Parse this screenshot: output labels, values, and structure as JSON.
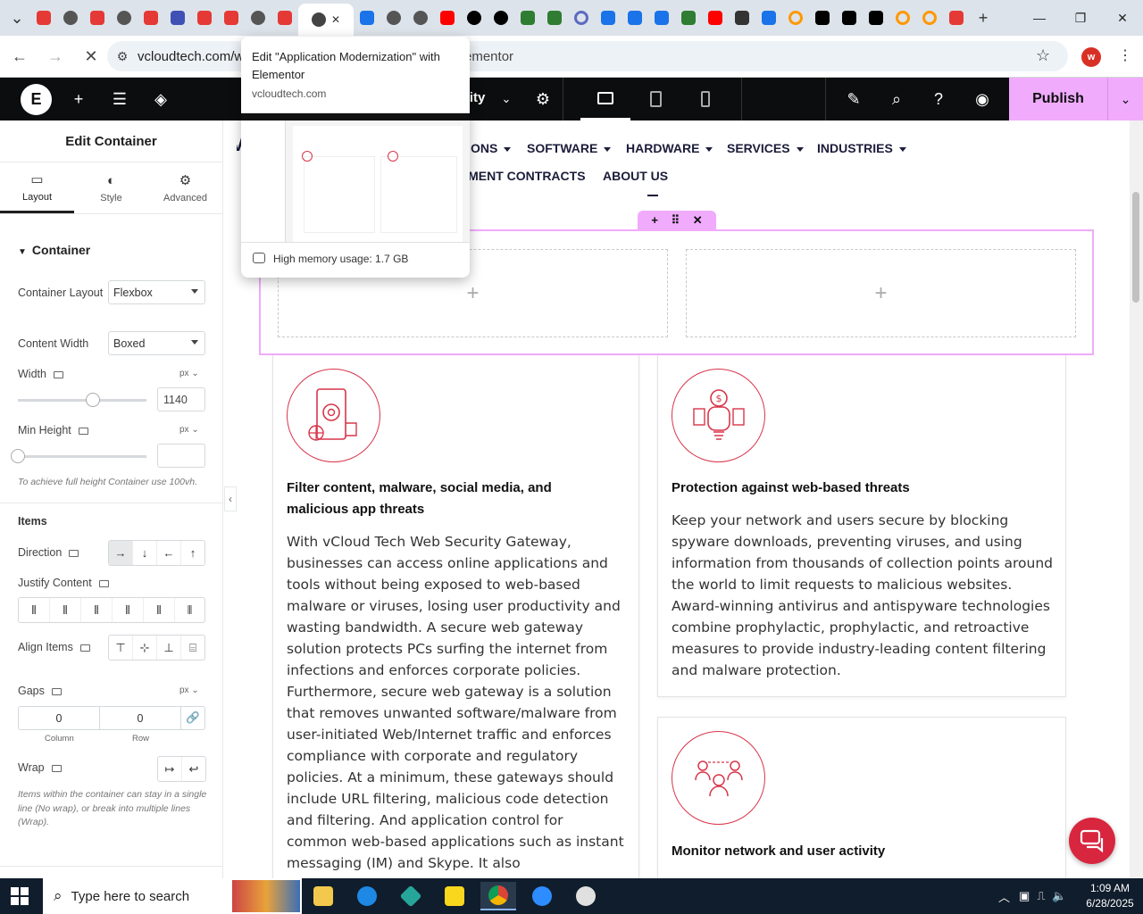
{
  "browser": {
    "tabs": [
      {
        "icon": "shield-tab-icon",
        "color": "#e53935"
      },
      {
        "icon": "globe-tab-icon",
        "color": "#555555"
      },
      {
        "icon": "shield-tab-icon",
        "color": "#e53935"
      },
      {
        "icon": "globe-tab-icon",
        "color": "#555555"
      },
      {
        "icon": "shield-tab-icon",
        "color": "#e53935"
      },
      {
        "icon": "gear-tab-icon",
        "color": "#3f51b5"
      },
      {
        "icon": "shield-tab-icon",
        "color": "#e53935"
      },
      {
        "icon": "shield-tab-icon",
        "color": "#e53935"
      },
      {
        "icon": "globe-tab-icon",
        "color": "#555555"
      },
      {
        "icon": "shield-tab-icon",
        "color": "#e53935"
      },
      {
        "icon": "globe-tab-icon",
        "color": "#444444",
        "active": true
      },
      {
        "icon": "chart-tab-icon",
        "color": "#1a73e8"
      },
      {
        "icon": "globe-tab-icon",
        "color": "#555555"
      },
      {
        "icon": "globe-tab-icon",
        "color": "#555555"
      },
      {
        "icon": "youtube-tab-icon",
        "color": "#ff0000"
      },
      {
        "icon": "threads-tab-icon",
        "color": "#000000"
      },
      {
        "icon": "threads-tab-icon",
        "color": "#000000"
      },
      {
        "icon": "bolt-tab-icon",
        "color": "#2e7d32"
      },
      {
        "icon": "bolt-tab-icon",
        "color": "#2e7d32"
      },
      {
        "icon": "ring-tab-icon",
        "color": "#5c6bc0"
      },
      {
        "icon": "chart-tab-icon",
        "color": "#1a73e8"
      },
      {
        "icon": "dots-tab-icon",
        "color": "#1a73e8"
      },
      {
        "icon": "dots-tab-icon",
        "color": "#1a73e8"
      },
      {
        "icon": "bolt-tab-icon",
        "color": "#2e7d32"
      },
      {
        "icon": "youtube-tab-icon",
        "color": "#ff0000"
      },
      {
        "icon": "lock-tab-icon",
        "color": "#333333"
      },
      {
        "icon": "wave-tab-icon",
        "color": "#1a73e8"
      },
      {
        "icon": "ring-tab-icon",
        "color": "#ff9800"
      },
      {
        "icon": "x-tab-icon",
        "color": "#000000"
      },
      {
        "icon": "x-tab-icon",
        "color": "#000000"
      },
      {
        "icon": "n-tab-icon",
        "color": "#000000"
      },
      {
        "icon": "ring-tab-icon",
        "color": "#ff9800"
      },
      {
        "icon": "ring-tab-icon",
        "color": "#ff9800"
      },
      {
        "icon": "slash-tab-icon",
        "color": "#e53935"
      }
    ],
    "url": "vcloudtech.com/w",
    "url_tail": "ementor",
    "profile_initial": "w"
  },
  "tooltip": {
    "title": "Edit \"Application Modernization\" with Elementor",
    "domain": "vcloudtech.com",
    "memory": "High memory usage: 1.7 GB"
  },
  "editor": {
    "site_name_fragment": "rity",
    "publish_label": "Publish"
  },
  "panel": {
    "title": "Edit Container",
    "tabs": [
      "Layout",
      "Style",
      "Advanced"
    ],
    "section": "Container",
    "container_layout_label": "Container Layout",
    "container_layout_value": "Flexbox",
    "content_width_label": "Content Width",
    "content_width_value": "Boxed",
    "width_label": "Width",
    "width_unit": "px",
    "width_value": "1140",
    "width_slider_fraction": 0.58,
    "min_height_label": "Min Height",
    "min_height_unit": "px",
    "min_height_value": "",
    "min_height_slider_fraction": 0,
    "min_height_hint": "To achieve full height Container use 100vh.",
    "items_heading": "Items",
    "direction_label": "Direction",
    "direction_options": [
      "→",
      "↓",
      "←",
      "↑"
    ],
    "direction_selected": 0,
    "justify_label": "Justify Content",
    "align_label": "Align Items",
    "gaps_label": "Gaps",
    "gaps_unit": "px",
    "gap_column": "0",
    "gap_row": "0",
    "gap_column_label": "Column",
    "gap_row_label": "Row",
    "wrap_label": "Wrap",
    "wrap_hint": "Items within the container can stay in a single line (No wrap), or break into multiple lines (Wrap)."
  },
  "site": {
    "menu_row1": [
      "ONS",
      "SOFTWARE",
      "HARDWARE",
      "SERVICES",
      "INDUSTRIES"
    ],
    "menu_row2": [
      "NMENT CONTRACTS",
      "ABOUT US"
    ],
    "cards": [
      {
        "title": "Filter content, malware, social media, and malicious app threats",
        "body": "With vCloud Tech Web Security Gateway, businesses can access online applications and tools without being exposed to web-based malware or viruses, losing user productivity and wasting bandwidth. A secure web gateway solution protects PCs surfing the internet from infections and enforces corporate policies. Furthermore, secure web gateway is a solution that removes unwanted software/malware from user-initiated Web/Internet traffic and enforces compliance with corporate and regulatory policies. At a minimum, these gateways should include URL filtering, malicious code detection and filtering. And application control for common web-based applications such as instant messaging (IM) and Skype. It also"
      },
      {
        "title": "Protection against web-based threats",
        "body": "Keep your network and users secure by blocking spyware downloads, preventing viruses, and using information from thousands of collection points around the world to limit requests to malicious websites. Award-winning antivirus and antispyware technologies combine prophylactic, prophylactic, and retroactive measures to provide industry-leading content filtering and malware protection."
      },
      {
        "title": "Monitor network and user activity",
        "body": ""
      }
    ],
    "accent": "#d8354a"
  },
  "taskbar": {
    "search_placeholder": "Type here to search",
    "time": "1:09 AM",
    "date": "6/28/2025"
  }
}
